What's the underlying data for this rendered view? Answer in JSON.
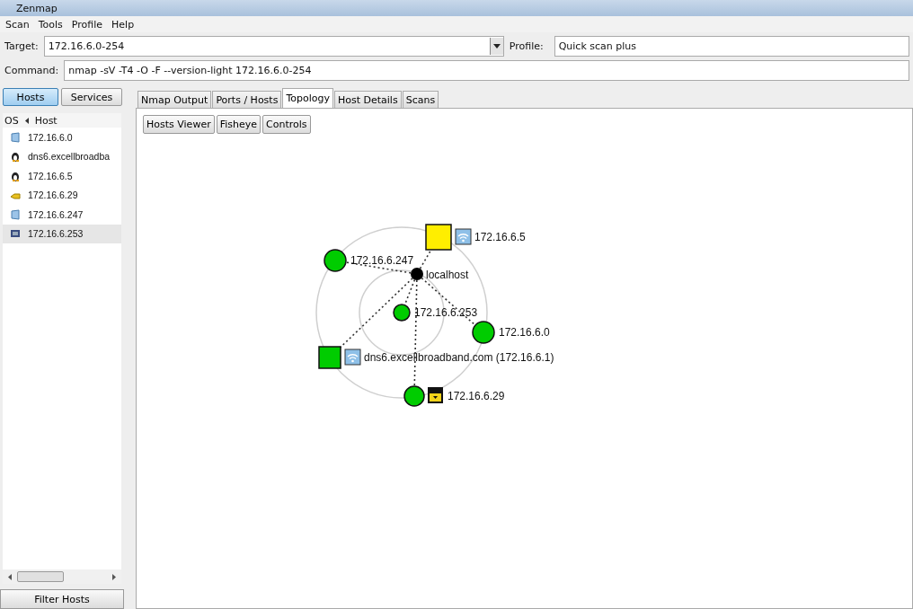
{
  "window": {
    "title": "Zenmap"
  },
  "menu": [
    "Scan",
    "Tools",
    "Profile",
    "Help"
  ],
  "target": {
    "label": "Target:",
    "value": "172.16.6.0-254"
  },
  "profile": {
    "label": "Profile:",
    "value": "Quick scan plus"
  },
  "command": {
    "label": "Command:",
    "value": "nmap -sV -T4 -O -F --version-light 172.16.6.0-254"
  },
  "view_toggle": [
    {
      "label": "Hosts",
      "selected": true
    },
    {
      "label": "Services",
      "selected": false
    }
  ],
  "host_list": {
    "columns": [
      "OS",
      "Host"
    ],
    "rows": [
      {
        "kind": "windows",
        "host": "172.16.6.0",
        "selected": false
      },
      {
        "kind": "linux",
        "host": "dns6.excellbroadba",
        "selected": false
      },
      {
        "kind": "linux",
        "host": "172.16.6.5",
        "selected": false
      },
      {
        "kind": "other",
        "host": "172.16.6.29",
        "selected": false
      },
      {
        "kind": "windows",
        "host": "172.16.6.247",
        "selected": false
      },
      {
        "kind": "mac",
        "host": "172.16.6.253",
        "selected": true
      }
    ]
  },
  "filter_button": "Filter Hosts",
  "tabs": [
    {
      "label": "Nmap Output",
      "selected": false
    },
    {
      "label": "Ports / Hosts",
      "selected": false
    },
    {
      "label": "Topology",
      "selected": true
    },
    {
      "label": "Host Details",
      "selected": false
    },
    {
      "label": "Scans",
      "selected": false
    }
  ],
  "topology_buttons": [
    "Hosts Viewer",
    "Fisheye",
    "Controls"
  ],
  "topology": {
    "center": {
      "label": "localhost"
    },
    "nodes": [
      {
        "kind": "square",
        "color": "#ffee00",
        "label": "172.16.6.5",
        "badge": {
          "kind": "wifi"
        }
      },
      {
        "kind": "circle",
        "color": "#00cc00",
        "label": "172.16.6.247"
      },
      {
        "kind": "circle",
        "color": "#00cc00",
        "label": "172.16.6.253"
      },
      {
        "kind": "circle",
        "color": "#00cc00",
        "label": "172.16.6.0"
      },
      {
        "kind": "square",
        "color": "#00cc00",
        "label": "dns6.excellbroadband.com (172.16.6.1)",
        "badge": {
          "kind": "wifi"
        }
      },
      {
        "kind": "circle",
        "color": "#00cc00",
        "label": "172.16.6.29",
        "badge": {
          "kind": "lock"
        }
      }
    ]
  }
}
